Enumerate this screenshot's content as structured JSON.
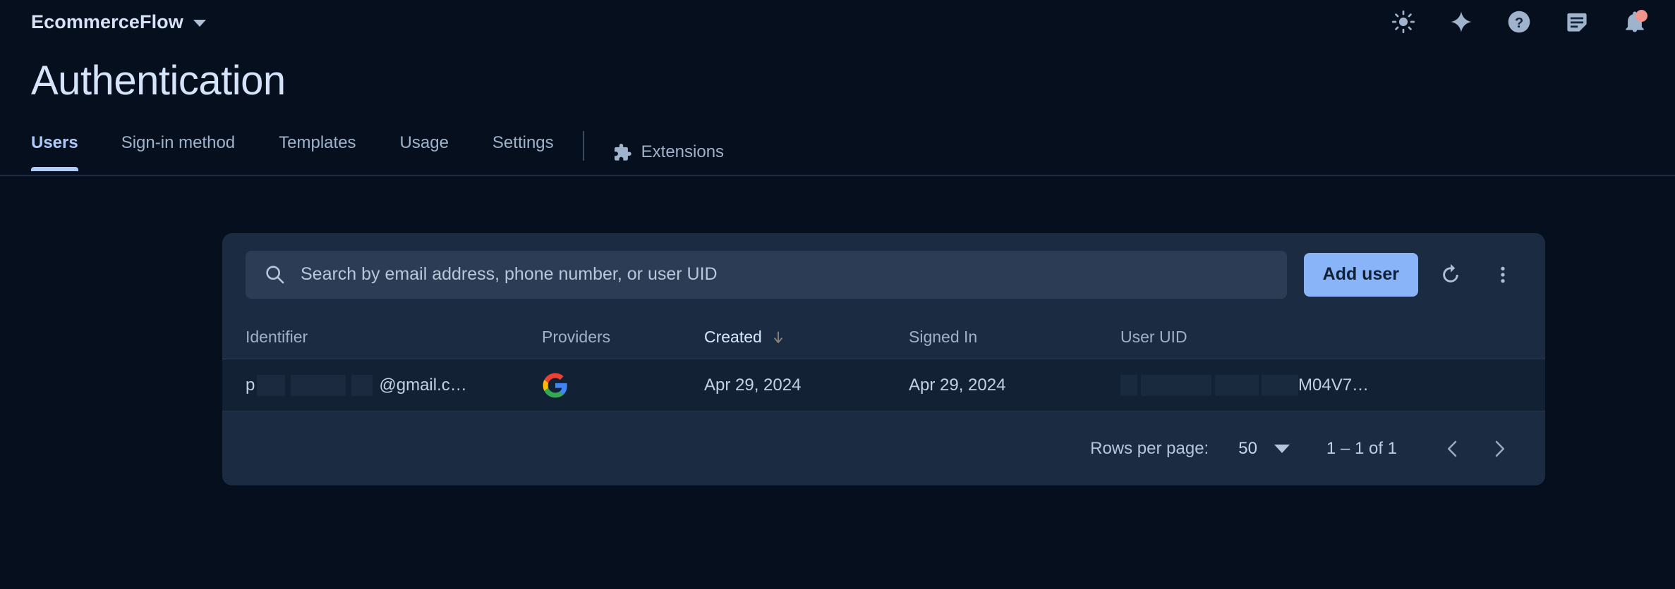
{
  "topbar": {
    "project_name": "EcommerceFlow",
    "icons": [
      {
        "name": "brightness-icon",
        "label": "Toggle light mode"
      },
      {
        "name": "sparkle-icon",
        "label": "Gemini"
      },
      {
        "name": "help-icon",
        "label": "Help"
      },
      {
        "name": "feedback-icon",
        "label": "Send feedback"
      },
      {
        "name": "notifications-icon",
        "label": "Notifications",
        "badge": true
      }
    ],
    "badge_color": "#f2958c"
  },
  "header": {
    "title": "Authentication"
  },
  "tabs": [
    {
      "label": "Users",
      "active": true
    },
    {
      "label": "Sign-in method",
      "active": false
    },
    {
      "label": "Templates",
      "active": false
    },
    {
      "label": "Usage",
      "active": false
    },
    {
      "label": "Settings",
      "active": false
    },
    {
      "label": "Extensions",
      "active": false,
      "icon": "extensions-puzzle-icon"
    }
  ],
  "toolbar": {
    "search_placeholder": "Search by email address, phone number, or user UID",
    "search_value": "",
    "add_user_label": "Add user",
    "refresh_label": "Refresh",
    "more_label": "More options",
    "accent_color": "#8ab4f8"
  },
  "table": {
    "columns": [
      {
        "key": "identifier",
        "label": "Identifier",
        "sorted": false
      },
      {
        "key": "providers",
        "label": "Providers",
        "sorted": false
      },
      {
        "key": "created",
        "label": "Created",
        "sorted": true,
        "sort_direction": "desc"
      },
      {
        "key": "signed_in",
        "label": "Signed In",
        "sorted": false
      },
      {
        "key": "user_uid",
        "label": "User UID",
        "sorted": false
      }
    ],
    "rows": [
      {
        "identifier_prefix": "p",
        "identifier_suffix": "@gmail.c…",
        "identifier_redacted": true,
        "provider": "google-logo-icon",
        "created": "Apr 29, 2024",
        "signed_in": "Apr 29, 2024",
        "user_uid_suffix": "M04V7…",
        "user_uid_redacted": true
      }
    ]
  },
  "footer": {
    "rows_per_page_label": "Rows per page:",
    "rows_per_page_value": "50",
    "range_label": "1 – 1 of 1",
    "prev_label": "Previous page",
    "next_label": "Next page"
  }
}
